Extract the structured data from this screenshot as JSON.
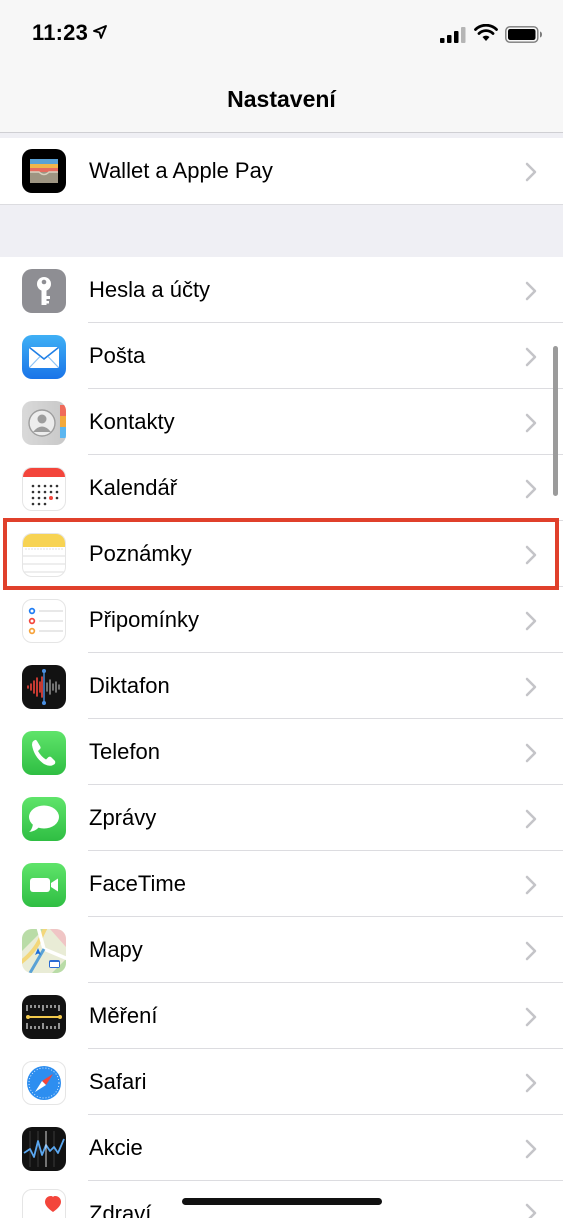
{
  "status_bar": {
    "time": "11:23"
  },
  "nav": {
    "title": "Nastavení"
  },
  "items": [
    {
      "label": "Wallet a Apple Pay",
      "icon": "wallet-icon"
    },
    {
      "label": "Hesla a účty",
      "icon": "key-icon"
    },
    {
      "label": "Pošta",
      "icon": "mail-icon"
    },
    {
      "label": "Kontakty",
      "icon": "contacts-icon"
    },
    {
      "label": "Kalendář",
      "icon": "calendar-icon"
    },
    {
      "label": "Poznámky",
      "icon": "notes-icon"
    },
    {
      "label": "Připomínky",
      "icon": "reminders-icon"
    },
    {
      "label": "Diktafon",
      "icon": "voice-memos-icon"
    },
    {
      "label": "Telefon",
      "icon": "phone-icon"
    },
    {
      "label": "Zprávy",
      "icon": "messages-icon"
    },
    {
      "label": "FaceTime",
      "icon": "facetime-icon"
    },
    {
      "label": "Mapy",
      "icon": "maps-icon"
    },
    {
      "label": "Měření",
      "icon": "measure-icon"
    },
    {
      "label": "Safari",
      "icon": "safari-icon"
    },
    {
      "label": "Akcie",
      "icon": "stocks-icon"
    },
    {
      "label": "Zdraví",
      "icon": "health-icon"
    }
  ],
  "highlight_color": "#e0402b"
}
